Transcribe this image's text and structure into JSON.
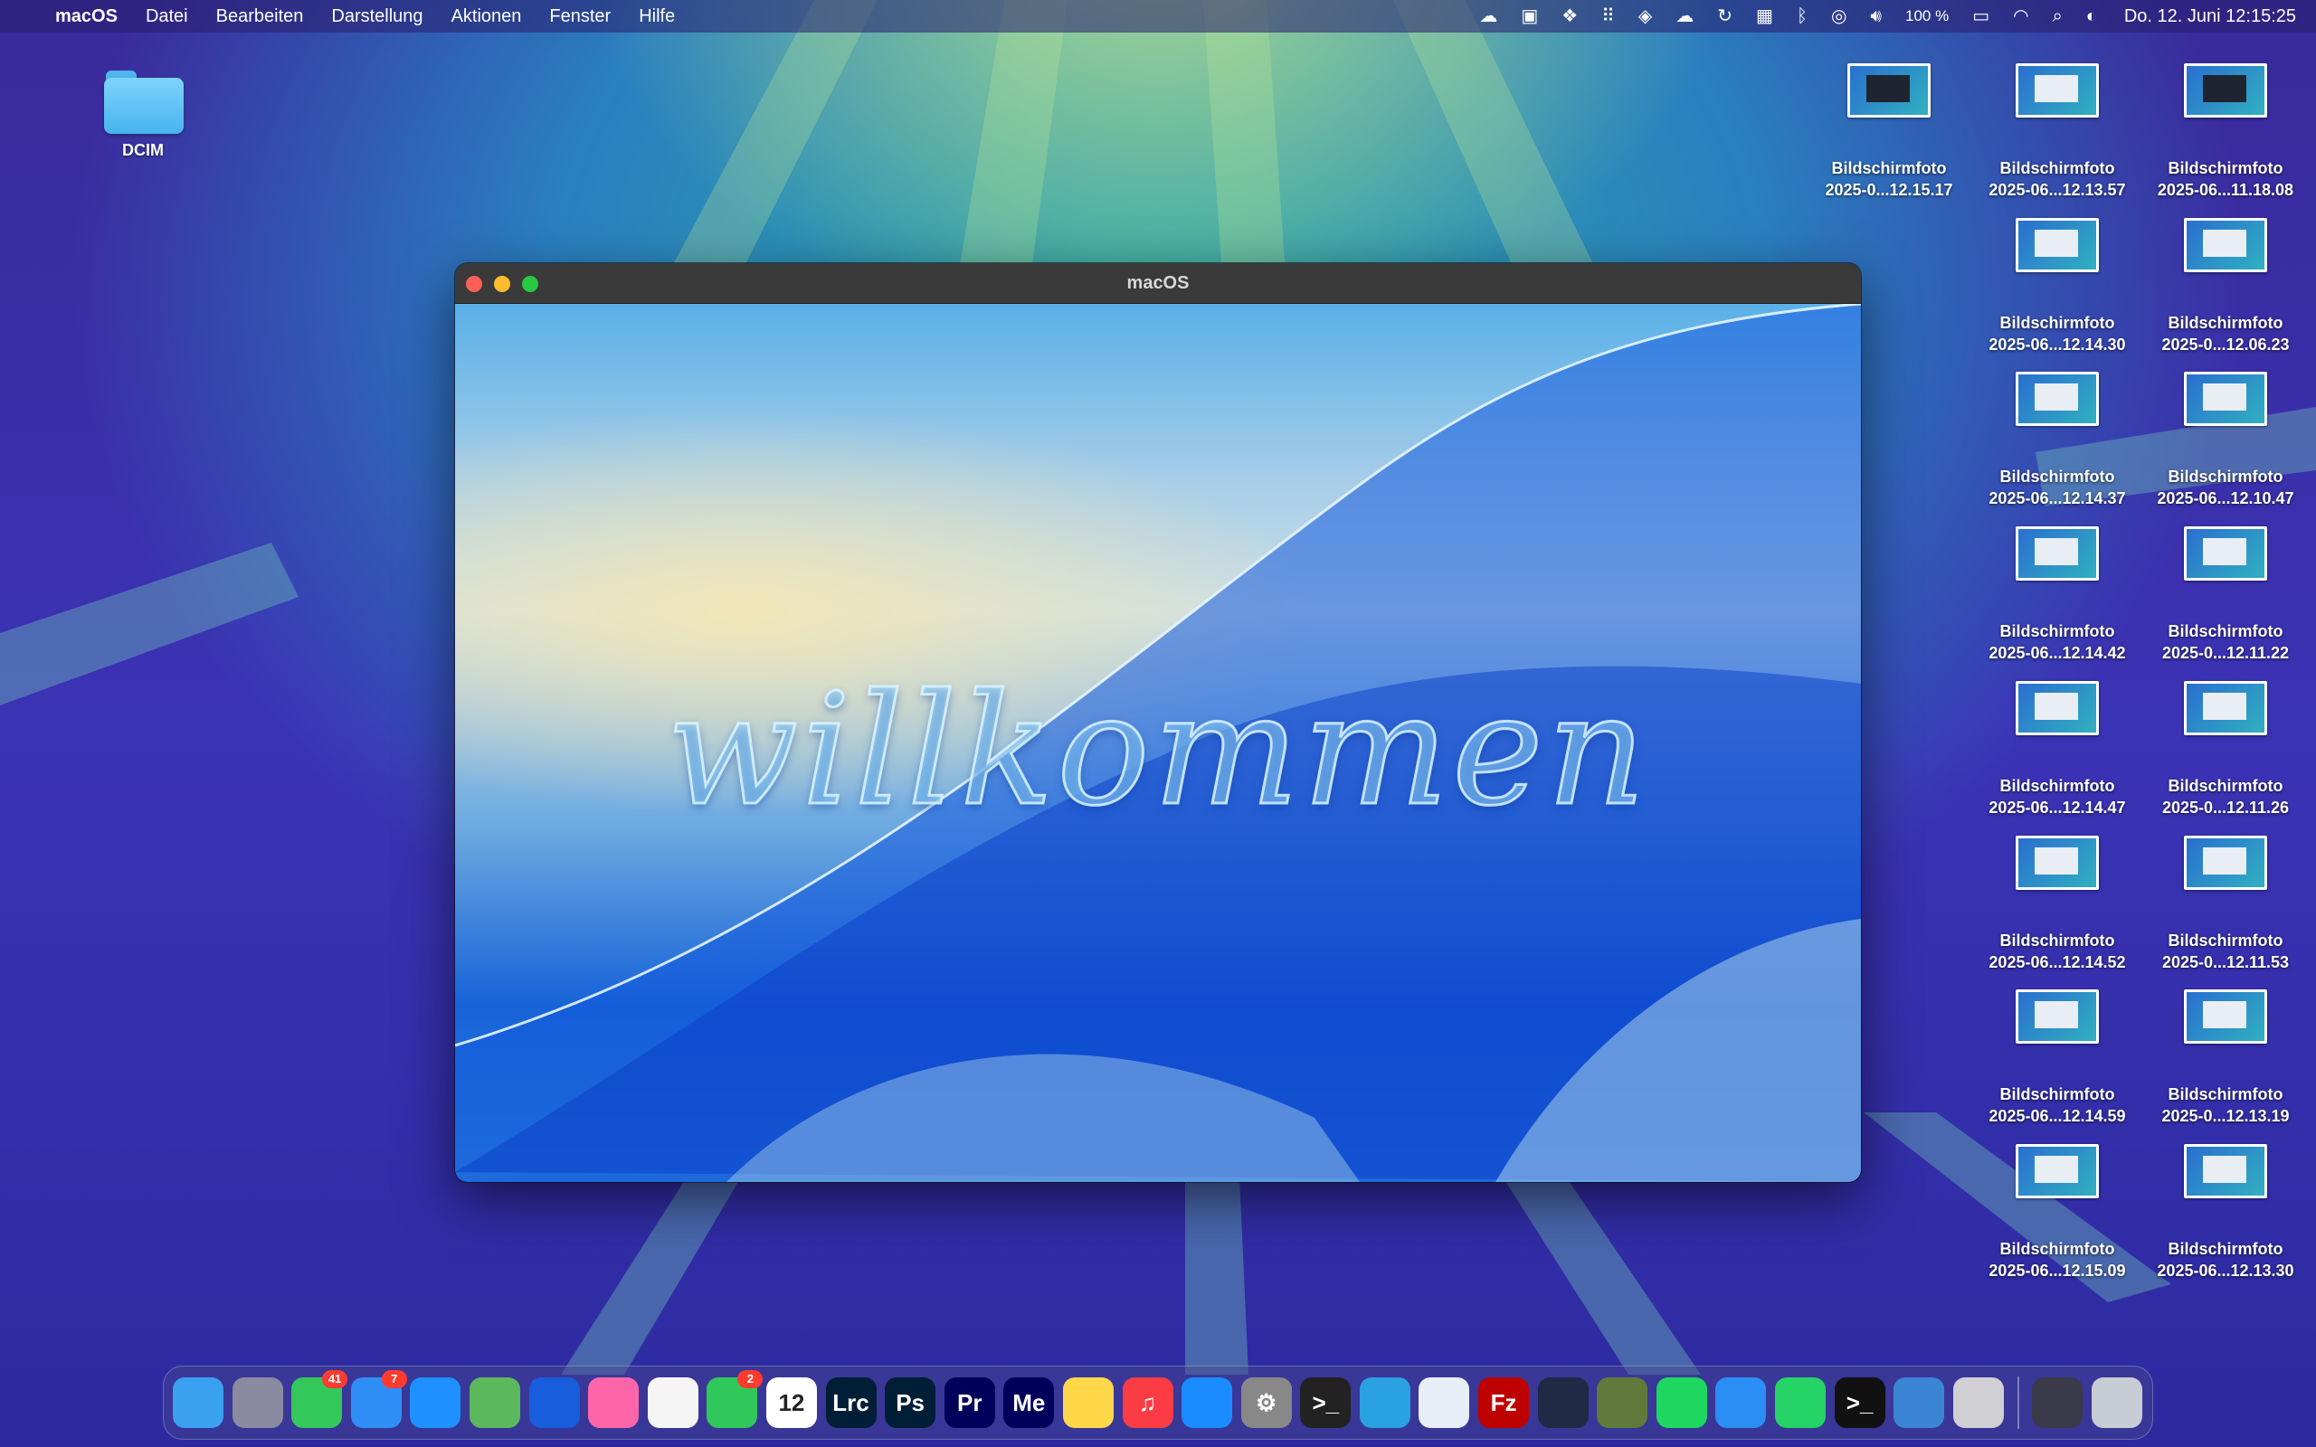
{
  "menubar": {
    "apple": "",
    "app_name": "macOS",
    "menus": [
      "Datei",
      "Bearbeiten",
      "Darstellung",
      "Aktionen",
      "Fenster",
      "Hilfe"
    ],
    "status_icons": [
      "creative-cloud-icon",
      "screen-share-icon",
      "dropbox-icon",
      "grid-icon",
      "layers-icon",
      "cloud-icon",
      "sync-icon",
      "layout-icon",
      "bluetooth-icon",
      "airdrop-icon",
      "volume-icon"
    ],
    "battery_text": "100 %",
    "clock": "Do. 12. Juni  12:15:25"
  },
  "desktop": {
    "folder": {
      "label": "DCIM"
    },
    "screenshots": [
      {
        "line1": "Bildschirmfoto",
        "line2": "2025-0...12.15.17",
        "dark": true
      },
      {
        "line1": "Bildschirmfoto",
        "line2": "2025-06...12.13.57",
        "dark": false
      },
      {
        "line1": "Bildschirmfoto",
        "line2": "2025-06...11.18.08",
        "dark": true
      },
      {
        "line1": "Bildschirmfoto",
        "line2": "2025-06...12.14.30",
        "dark": false
      },
      {
        "line1": "Bildschirmfoto",
        "line2": "2025-0...12.06.23",
        "dark": false
      },
      {
        "line1": "Bildschirmfoto",
        "line2": "2025-06...12.14.37",
        "dark": false
      },
      {
        "line1": "Bildschirmfoto",
        "line2": "2025-06...12.10.47",
        "dark": false
      },
      {
        "line1": "Bildschirmfoto",
        "line2": "2025-06...12.14.42",
        "dark": false
      },
      {
        "line1": "Bildschirmfoto",
        "line2": "2025-0...12.11.22",
        "dark": false
      },
      {
        "line1": "Bildschirmfoto",
        "line2": "2025-06...12.14.47",
        "dark": false
      },
      {
        "line1": "Bildschirmfoto",
        "line2": "2025-0...12.11.26",
        "dark": false
      },
      {
        "line1": "Bildschirmfoto",
        "line2": "2025-06...12.14.52",
        "dark": false
      },
      {
        "line1": "Bildschirmfoto",
        "line2": "2025-0...12.11.53",
        "dark": false
      },
      {
        "line1": "Bildschirmfoto",
        "line2": "2025-06...12.14.59",
        "dark": false
      },
      {
        "line1": "Bildschirmfoto",
        "line2": "2025-0...12.13.19",
        "dark": false
      },
      {
        "line1": "Bildschirmfoto",
        "line2": "2025-06...12.15.09",
        "dark": false
      },
      {
        "line1": "Bildschirmfoto",
        "line2": "2025-06...12.13.30",
        "dark": false
      }
    ]
  },
  "window": {
    "title": "macOS",
    "welcome_text": "willkommen"
  },
  "dock": {
    "items": [
      {
        "name": "finder-icon",
        "text": "",
        "color": "#3aa0f0"
      },
      {
        "name": "launchpad-icon",
        "text": "",
        "color": "#8a8aa0"
      },
      {
        "name": "messages-icon",
        "text": "",
        "color": "#34c759",
        "badge": "41"
      },
      {
        "name": "mail-icon",
        "text": "",
        "color": "#2f8ef5",
        "badge": "7"
      },
      {
        "name": "safari-icon",
        "text": "",
        "color": "#1e90ff"
      },
      {
        "name": "maps-icon",
        "text": "",
        "color": "#5cb85c"
      },
      {
        "name": "bitwarden-icon",
        "text": "",
        "color": "#175ddc"
      },
      {
        "name": "photos-icon",
        "text": "",
        "color": "#f6a"
      },
      {
        "name": "photos-alt-icon",
        "text": "",
        "color": "#f5f5f5"
      },
      {
        "name": "facetime-icon",
        "text": "",
        "color": "#30c85a",
        "badge": "2"
      },
      {
        "name": "calendar-icon",
        "text": "12",
        "color": "#ffffff"
      },
      {
        "name": "lightroom-icon",
        "text": "Lrc",
        "color": "#001e36"
      },
      {
        "name": "photoshop-icon",
        "text": "Ps",
        "color": "#001e36"
      },
      {
        "name": "premiere-icon",
        "text": "Pr",
        "color": "#00005b"
      },
      {
        "name": "media-encoder-icon",
        "text": "Me",
        "color": "#00005b"
      },
      {
        "name": "notes-icon",
        "text": "",
        "color": "#ffd84a"
      },
      {
        "name": "music-icon",
        "text": "♫",
        "color": "#fc3c44"
      },
      {
        "name": "app-store-icon",
        "text": "",
        "color": "#1a8cff"
      },
      {
        "name": "system-settings-icon",
        "text": "⚙",
        "color": "#888"
      },
      {
        "name": "terminal-icon",
        "text": ">_",
        "color": "#222"
      },
      {
        "name": "telegram-icon",
        "text": "",
        "color": "#2aa1e0"
      },
      {
        "name": "app-icon",
        "text": "",
        "color": "#e8eef7"
      },
      {
        "name": "filezilla-icon",
        "text": "Fz",
        "color": "#bf0000"
      },
      {
        "name": "wordpress-icon",
        "text": "",
        "color": "#1f2a44"
      },
      {
        "name": "xcode-globe-icon",
        "text": "",
        "color": "#5f7a3a"
      },
      {
        "name": "spotify-icon",
        "text": "",
        "color": "#1ed760"
      },
      {
        "name": "windows-app-icon",
        "text": "",
        "color": "#2b8ef5"
      },
      {
        "name": "whatsapp-icon",
        "text": "",
        "color": "#25d366"
      },
      {
        "name": "terminal-alt-icon",
        "text": ">_",
        "color": "#111"
      },
      {
        "name": "xcode-beta-icon",
        "text": "",
        "color": "#3b86d4"
      },
      {
        "name": "apple-icon",
        "text": "",
        "color": "#cfcfd4"
      }
    ],
    "trailing": [
      {
        "name": "recent-app-icon",
        "text": "",
        "color": "#3a3a4a"
      },
      {
        "name": "trash-icon",
        "text": "",
        "color": "#c8ccd4"
      }
    ]
  }
}
